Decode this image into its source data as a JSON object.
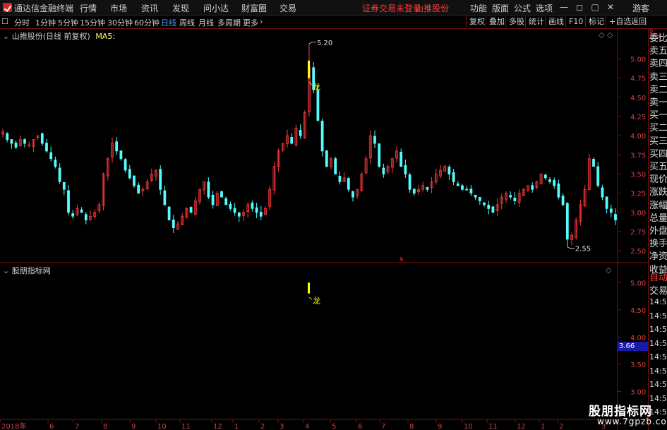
{
  "menubar": {
    "app_title": "通达信金融终端",
    "items": [
      "行情",
      "市场",
      "资讯",
      "发现",
      "问小达",
      "财富圈",
      "交易"
    ],
    "trade_status": "证券交易未登录",
    "stock_name": "山推股份",
    "right_items": [
      "功能",
      "版面",
      "公式",
      "选项"
    ],
    "guest": "游客"
  },
  "periodbar": {
    "periods": [
      "分时",
      "1分钟",
      "5分钟",
      "15分钟",
      "30分钟",
      "60分钟",
      "日线",
      "周线",
      "月线",
      "多周期",
      "更多"
    ],
    "active": "日线",
    "tools": [
      "复权",
      "叠加",
      "多股",
      "统计",
      "画线",
      "F10",
      "标记",
      "+自选",
      "返回"
    ]
  },
  "main_panel": {
    "title": "山推股份(日线 前复权)",
    "ma_label": "MA5:",
    "high_label": "5.20",
    "low_label": "2.55",
    "dragon_label": "龙",
    "s_marker": "s"
  },
  "sub_panel": {
    "title": "股朋指标网",
    "dragon_label": "龙"
  },
  "price_tag": "3.66",
  "chart_data": [
    {
      "type": "candlestick",
      "title": "山推股份(日线 前复权)",
      "yticks": [
        "5.00",
        "4.75",
        "4.50",
        "4.25",
        "4.00",
        "3.75",
        "3.50",
        "3.25",
        "3.00",
        "2.75",
        "2.50"
      ],
      "ylim": [
        2.4,
        5.3
      ],
      "annotations": [
        {
          "label": "5.20",
          "value": 5.2
        },
        {
          "label": "2.55",
          "value": 2.55
        }
      ],
      "approx_close": [
        4.05,
        3.95,
        3.9,
        3.85,
        3.95,
        3.9,
        3.88,
        3.95,
        4.0,
        3.9,
        3.8,
        3.7,
        3.6,
        3.4,
        3.3,
        3.0,
        2.95,
        3.05,
        3.0,
        2.9,
        2.95,
        3.0,
        3.1,
        3.5,
        3.7,
        3.9,
        3.8,
        3.7,
        3.55,
        3.45,
        3.35,
        3.25,
        3.3,
        3.4,
        3.5,
        3.55,
        3.3,
        3.1,
        2.9,
        2.8,
        2.85,
        2.95,
        3.05,
        3.0,
        3.15,
        3.3,
        3.4,
        3.2,
        3.1,
        3.25,
        3.2,
        3.1,
        3.05,
        3.0,
        2.95,
        3.0,
        3.1,
        3.05,
        3.0,
        2.95,
        3.05,
        3.3,
        3.6,
        3.8,
        3.9,
        4.0,
        3.9,
        4.1,
        4.0,
        4.3,
        4.9,
        4.6,
        4.2,
        3.8,
        3.6,
        3.7,
        3.5,
        3.4,
        3.45,
        3.3,
        3.2,
        3.3,
        3.5,
        3.7,
        4.0,
        3.9,
        3.6,
        3.5,
        3.6,
        3.7,
        3.8,
        3.6,
        3.5,
        3.3,
        3.25,
        3.3,
        3.35,
        3.3,
        3.4,
        3.5,
        3.55,
        3.6,
        3.5,
        3.4,
        3.35,
        3.3,
        3.3,
        3.25,
        3.2,
        3.15,
        3.1,
        3.05,
        3.0,
        3.1,
        3.2,
        3.25,
        3.2,
        3.15,
        3.25,
        3.3,
        3.35,
        3.3,
        3.4,
        3.5,
        3.45,
        3.4,
        3.35,
        3.2,
        3.1,
        2.65,
        2.7,
        2.9,
        3.1,
        3.3,
        3.7,
        3.6,
        3.35,
        3.2,
        3.05,
        3.0,
        2.9
      ],
      "xticks": [
        "2018年",
        "6",
        "7",
        "8",
        "9",
        "10",
        "11",
        "12",
        "1",
        "2",
        "3",
        "4",
        "5",
        "6",
        "7",
        "8",
        "9",
        "10",
        "11",
        "12",
        "1",
        "2",
        "3"
      ]
    },
    {
      "type": "indicator",
      "title": "股朋指标网",
      "yticks": [
        "5.00",
        "4.50",
        "4.00",
        "3.50",
        "3.00"
      ],
      "ylim": [
        2.85,
        5.25
      ],
      "signal": {
        "label": "龙"
      }
    }
  ],
  "right_panel": {
    "labels": [
      "委比",
      "卖五",
      "卖四",
      "卖三",
      "卖二",
      "卖一",
      "买一",
      "买二",
      "买三",
      "买四",
      "买五",
      "现价",
      "涨跌",
      "涨幅",
      "总量",
      "外盘",
      "换手",
      "净资",
      "收益",
      "自动",
      "交易"
    ],
    "times": [
      "14:56",
      "14:56",
      "14:56",
      "14:56",
      "14:56",
      "14:56",
      "14:56",
      "14:56",
      "14:56"
    ],
    "corner": [
      "0.",
      "1000"
    ]
  },
  "watermark": {
    "cn": "股朋指标网",
    "url": "www.7gpzb.com"
  },
  "colors": {
    "up": "#ff3b3b",
    "down": "#54fcfc",
    "axis": "#7a1010",
    "signal": "#ffff00",
    "active_tab": "#4a9eff"
  }
}
